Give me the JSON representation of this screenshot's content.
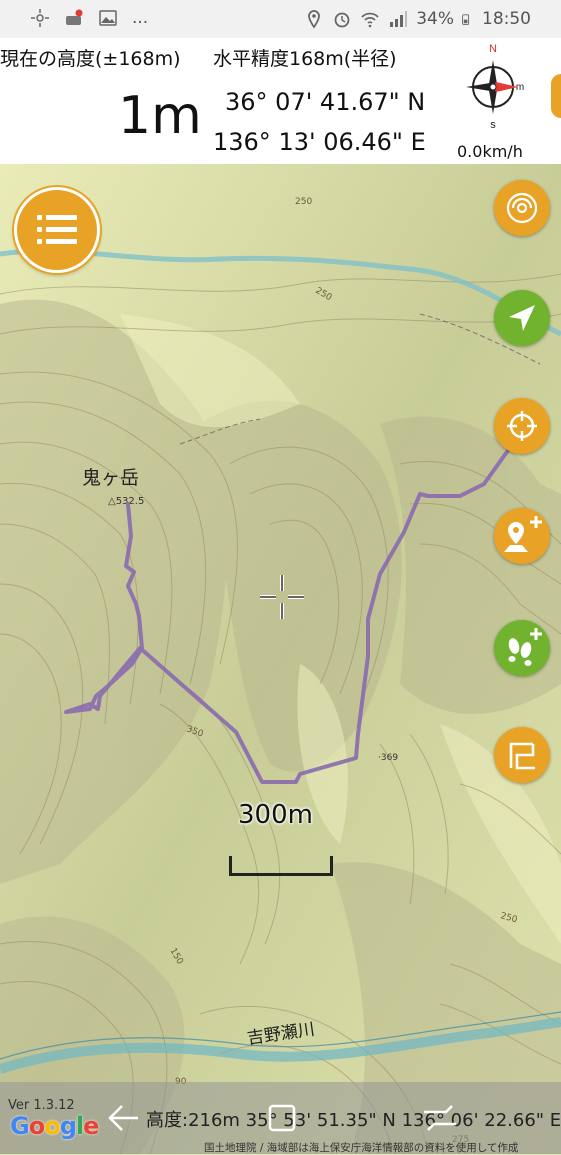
{
  "status_bar": {
    "icons_left": [
      "brightness-icon",
      "notification-icon",
      "image-icon",
      "more-icon"
    ],
    "more_text": "...",
    "battery": "34%",
    "time": "18:50"
  },
  "header": {
    "altitude_label": "現在の高度(±168m)",
    "accuracy_label": "水平精度168m(半径)",
    "altitude_value": "1m",
    "latitude": "36° 07' 41.67\" N",
    "longitude": "136° 13' 06.46\" E",
    "speed": "0.0km/h",
    "compass": {
      "n": "N",
      "s": "s",
      "m": "m"
    }
  },
  "map": {
    "peak_name": "鬼ヶ岳",
    "peak_elevation": "△532.5",
    "river_name": "吉野瀬川",
    "contour_labels": [
      "250",
      "350",
      "250",
      "150",
      "250",
      "·369",
      "90",
      "275"
    ],
    "scale_label": "300m",
    "track_color": "#8a6aaf",
    "colors": {
      "orange": "#e8a326",
      "green": "#71b22e"
    }
  },
  "buttons": {
    "menu": "menu-icon",
    "side": [
      {
        "name": "layer-button",
        "icon": "swirl-icon",
        "color": "orange"
      },
      {
        "name": "navigate-button",
        "icon": "navigation-arrow-icon",
        "color": "green"
      },
      {
        "name": "locate-button",
        "icon": "crosshair-icon",
        "color": "orange"
      },
      {
        "name": "add-waypoint-button",
        "icon": "map-pin-plus-icon",
        "color": "orange"
      },
      {
        "name": "add-track-button",
        "icon": "footprints-plus-icon",
        "color": "green"
      },
      {
        "name": "route-button",
        "icon": "route-icon",
        "color": "orange"
      }
    ]
  },
  "bottom": {
    "version": "Ver 1.3.12",
    "google": "Google",
    "nav_info": "高度:216m  35° 53' 51.35\" N  136° 06' 22.66\" E",
    "attribution": "国土地理院 / 海域部は海上保安庁海洋情報部の資料を使用して作成"
  }
}
